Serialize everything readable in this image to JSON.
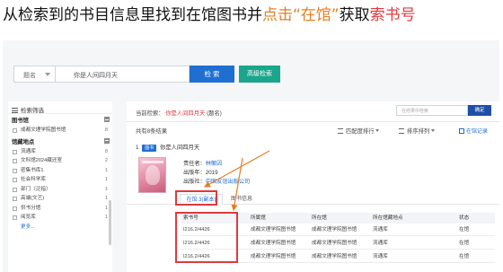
{
  "instruction": {
    "part1": "从检索到的书目信息里找到在馆图书并",
    "part2": "点击“在馆”",
    "part3": "获取",
    "part4": "索书号"
  },
  "search": {
    "field_label": "题名",
    "query": "你是人间四月天",
    "search_button": "检 索",
    "advanced_button": "高级检索"
  },
  "sidebar": {
    "header": "检索筛选",
    "sections": [
      {
        "title": "图书馆",
        "items": [
          {
            "label": "成都文理学院图书馆",
            "count": "8"
          }
        ]
      },
      {
        "title": "馆藏地点",
        "items": [
          {
            "label": "流通库",
            "count": "8"
          },
          {
            "label": "文科馆2024藏还室",
            "count": "2"
          },
          {
            "label": "密集书库1",
            "count": "1"
          },
          {
            "label": "社会科学库",
            "count": "1"
          },
          {
            "label": "部门（泛指）",
            "count": "1"
          },
          {
            "label": "高端(文艺)",
            "count": "1"
          },
          {
            "label": "供书分馆",
            "count": "1"
          },
          {
            "label": "阅览库",
            "count": "1"
          }
        ]
      }
    ],
    "more": "更多..."
  },
  "main": {
    "crumb_prefix": "当前检索：",
    "crumb_keyword": "你是人间四月天",
    "crumb_suffix": "(题名)",
    "in_result_placeholder": "在结果中检索",
    "confirm_button": "确定",
    "result_count": "共有8条结果",
    "sort_relevance": "匹配度排行",
    "sort_order": "排序排列",
    "holding_filter": "在馆记录"
  },
  "record": {
    "index": "1",
    "badge": "图书",
    "title": "你是人间四月天",
    "responsibility_label": "责任者：",
    "responsibility_value": "林徽因",
    "year_label": "出版年：",
    "year_value": "2019",
    "publisher_label": "出版社：",
    "publisher_value": "中国友谊出版公司",
    "tab_holding": "在馆  3(副本)",
    "tab_info": "图书信息"
  },
  "holdings": {
    "columns": [
      "索书号",
      "所属馆",
      "所在馆",
      "所在馆藏地点",
      "状态"
    ],
    "rows": [
      [
        "I216.2/4426",
        "成都文理学院图书馆",
        "成都文理学院图书馆",
        "流通库",
        "在馆"
      ],
      [
        "I216.2/4426",
        "成都文理学院图书馆",
        "成都文理学院图书馆",
        "流通库",
        "在馆"
      ],
      [
        "I216.2/4426",
        "成都文理学院图书馆",
        "成都文理学院图书馆",
        "流通库",
        "在馆"
      ]
    ]
  },
  "colors": {
    "accent_orange": "#e67e22",
    "accent_red": "#e0393e",
    "primary_blue": "#1f6fd1",
    "advanced_green": "#1aa68c"
  }
}
